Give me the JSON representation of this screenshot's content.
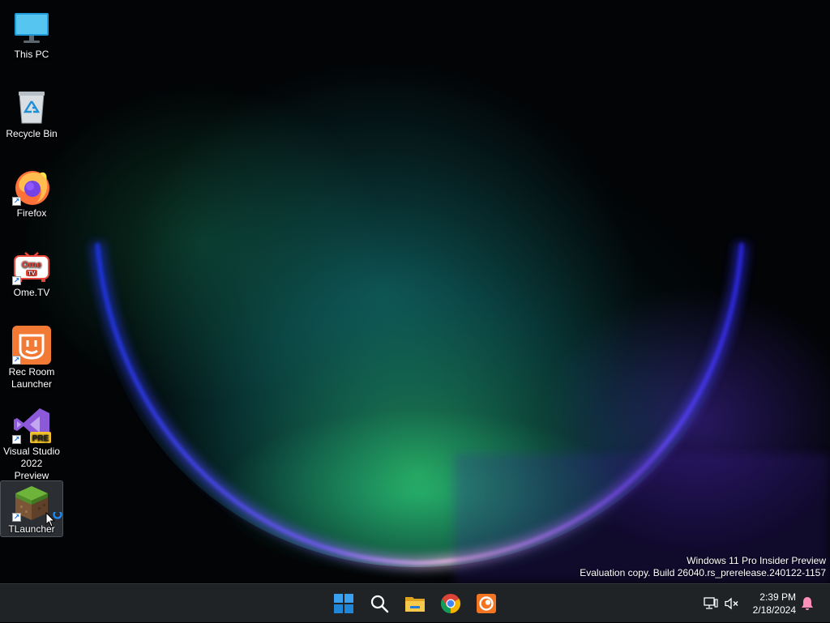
{
  "desktop": {
    "icons": [
      {
        "label": "This PC",
        "icon": "monitor-icon",
        "shortcut": false
      },
      {
        "label": "Recycle Bin",
        "icon": "recycle-bin-icon",
        "shortcut": false
      },
      {
        "label": "Firefox",
        "icon": "firefox-icon",
        "shortcut": true
      },
      {
        "label": "Ome.TV",
        "icon": "ometv-icon",
        "shortcut": true,
        "logo_text": "Ome",
        "logo_sub": "TV"
      },
      {
        "label": "Rec Room Launcher",
        "icon": "rec-room-icon",
        "shortcut": true
      },
      {
        "label": "Visual Studio 2022 Preview",
        "icon": "visual-studio-icon",
        "shortcut": true,
        "badge": "PRE"
      },
      {
        "label": "TLauncher",
        "icon": "minecraft-grass-block-icon",
        "shortcut": true,
        "selected": true
      }
    ],
    "shortcut_arrow": "↗"
  },
  "watermark": {
    "line1": "Windows 11 Pro Insider Preview",
    "line2": "Evaluation copy. Build 26040.rs_prerelease.240122-1157"
  },
  "taskbar": {
    "apps": [
      {
        "name": "Start",
        "icon": "windows-start-icon"
      },
      {
        "name": "Search",
        "icon": "search-icon"
      },
      {
        "name": "File Explorer",
        "icon": "folder-icon"
      },
      {
        "name": "Google Chrome",
        "icon": "chrome-icon"
      },
      {
        "name": "Crunchyroll",
        "icon": "crunchyroll-icon"
      }
    ],
    "tray": {
      "icons": [
        "network-icon",
        "speaker-muted-icon",
        "notification-bell-icon"
      ],
      "time": "2:39 PM",
      "date": "2/18/2024"
    }
  },
  "colors": {
    "taskbar_bg": "#202326",
    "start_blue": "#2b9be8",
    "ring_blue": "#3b5bff",
    "ring_pink": "#f0a8e8"
  }
}
